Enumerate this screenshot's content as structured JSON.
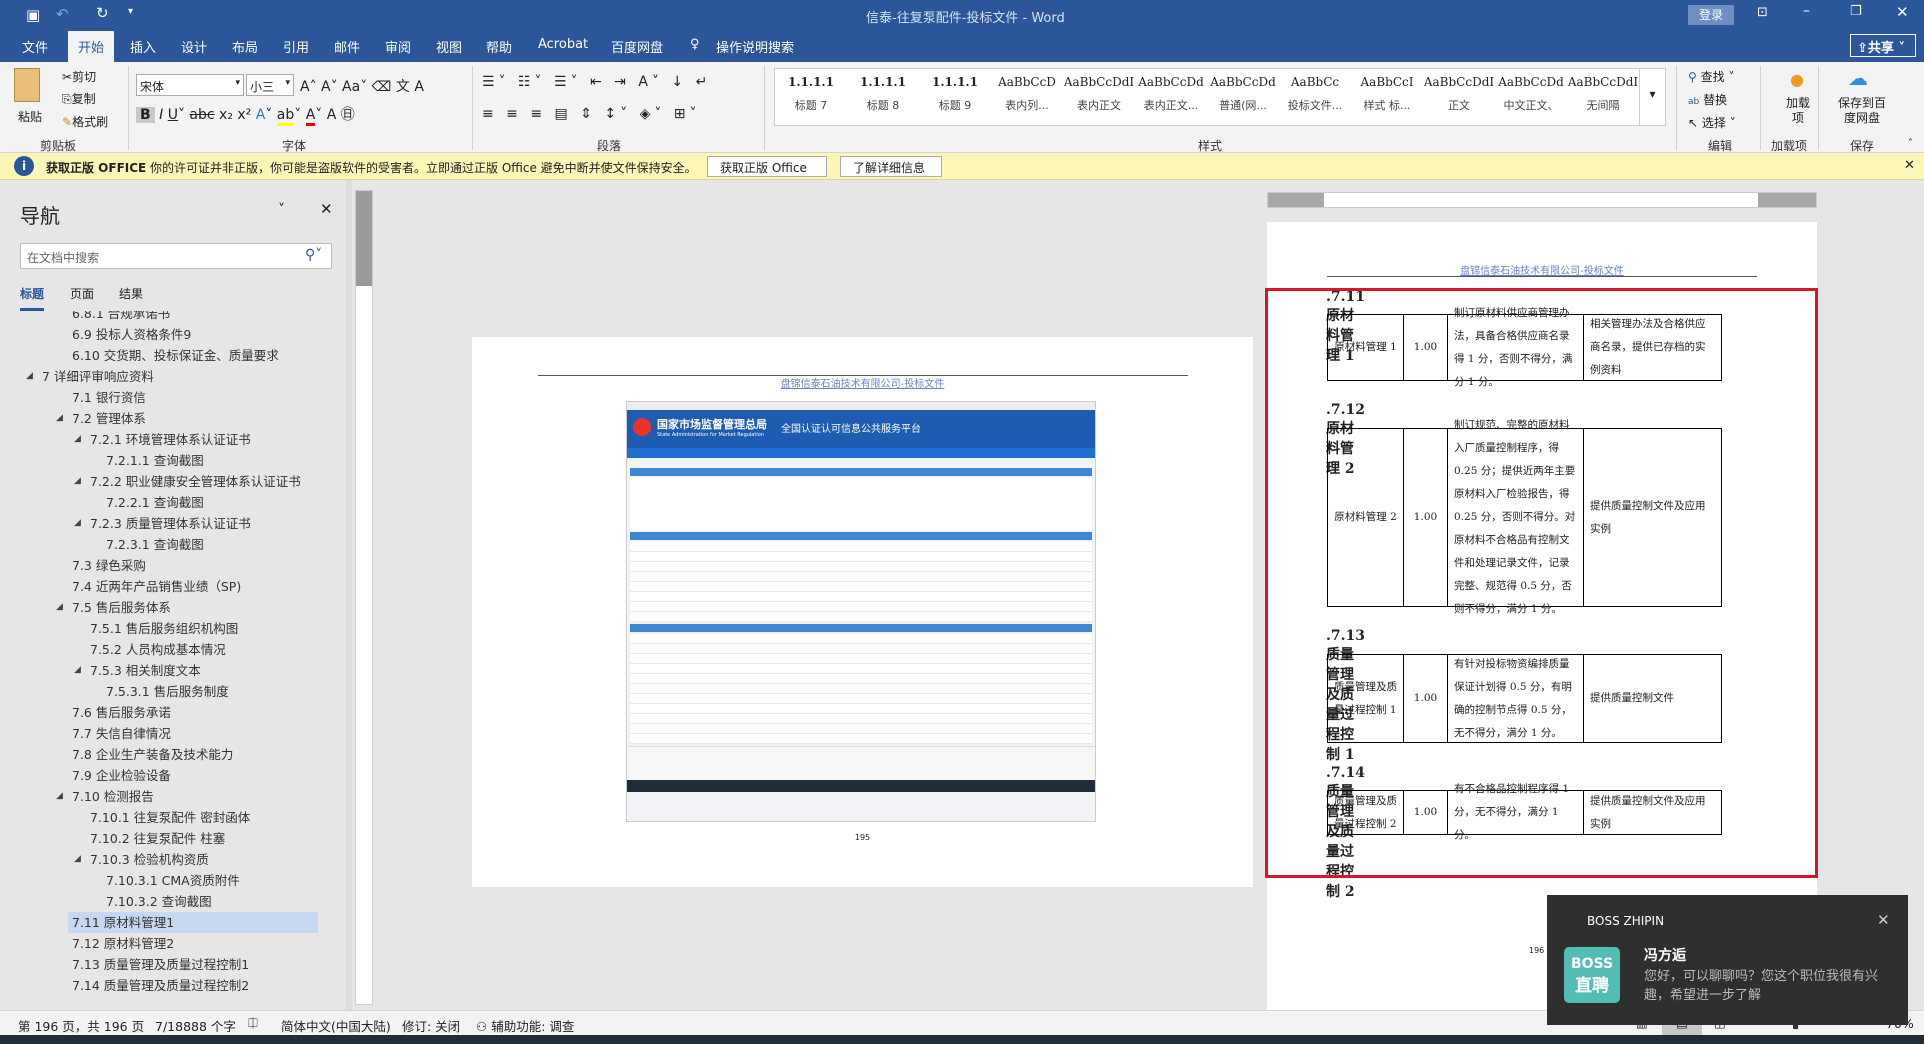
{
  "window": {
    "title": "信泰-往复泵配件-投标文件 - Word",
    "login": "登录"
  },
  "tabs": [
    "文件",
    "开始",
    "插入",
    "设计",
    "布局",
    "引用",
    "邮件",
    "审阅",
    "视图",
    "帮助",
    "Acrobat",
    "百度网盘"
  ],
  "active_tab": "开始",
  "tell_me": "操作说明搜索",
  "share": "共享",
  "ribbon": {
    "clipboard": {
      "paste": "粘贴",
      "cut": "剪切",
      "copy": "复制",
      "format_painter": "格式刷",
      "label": "剪贴板"
    },
    "font": {
      "name": "宋体",
      "size": "小三",
      "label": "字体"
    },
    "paragraph": {
      "label": "段落"
    },
    "styles": {
      "label": "样式",
      "items": [
        {
          "preview": "1.1.1.1",
          "name": "标题 7"
        },
        {
          "preview": "1.1.1.1",
          "name": "标题 8"
        },
        {
          "preview": "1.1.1.1",
          "name": "标题 9"
        },
        {
          "preview": "AaBbCcD",
          "name": "表内列..."
        },
        {
          "preview": "AaBbCcDdI",
          "name": "表内正文"
        },
        {
          "preview": "AaBbCcDd",
          "name": "表内正文..."
        },
        {
          "preview": "AaBbCcDd",
          "name": "普通(网..."
        },
        {
          "preview": "AaBbCc",
          "name": "投标文件..."
        },
        {
          "preview": "AaBbCcI",
          "name": "样式 标..."
        },
        {
          "preview": "AaBbCcDdI",
          "name": "正文"
        },
        {
          "preview": "AaBbCcDd",
          "name": "中文正文、"
        },
        {
          "preview": "AaBbCcDdI",
          "name": "无间隔"
        }
      ]
    },
    "editing": {
      "find": "查找",
      "replace": "替换",
      "select": "选择",
      "label": "编辑"
    },
    "addins": {
      "button": "加载项",
      "label": "加载项"
    },
    "save": {
      "button": "保存到百度网盘",
      "label": "保存"
    }
  },
  "message_bar": {
    "title": "获取正版 OFFICE",
    "text": "你的许可证并非正版，你可能是盗版软件的受害者。立即通过正版 Office 避免中断并使文件保持安全。",
    "btn1": "获取正版 Office",
    "btn2": "了解详细信息"
  },
  "nav": {
    "title": "导航",
    "search_placeholder": "在文档中搜索",
    "tabs": [
      "标题",
      "页面",
      "结果"
    ],
    "items": [
      {
        "t": "6.8.1 合规承诺书",
        "lvl": 2
      },
      {
        "t": "6.9 投标人资格条件9",
        "lvl": 2
      },
      {
        "t": "6.10 交货期、投标保证金、质量要求",
        "lvl": 2
      },
      {
        "t": "7 详细评审响应资料",
        "lvl": 1,
        "exp": true
      },
      {
        "t": "7.1 银行资信",
        "lvl": 2
      },
      {
        "t": "7.2 管理体系",
        "lvl": 2,
        "exp": true
      },
      {
        "t": "7.2.1 环境管理体系认证证书",
        "lvl": 3,
        "exp": true
      },
      {
        "t": "7.2.1.1 查询截图",
        "lvl": 4
      },
      {
        "t": "7.2.2 职业健康安全管理体系认证证书",
        "lvl": 3,
        "exp": true
      },
      {
        "t": "7.2.2.1 查询截图",
        "lvl": 4
      },
      {
        "t": "7.2.3 质量管理体系认证证书",
        "lvl": 3,
        "exp": true
      },
      {
        "t": "7.2.3.1 查询截图",
        "lvl": 4
      },
      {
        "t": "7.3 绿色采购",
        "lvl": 2
      },
      {
        "t": "7.4 近两年产品销售业绩（SP)",
        "lvl": 2
      },
      {
        "t": "7.5 售后服务体系",
        "lvl": 2,
        "exp": true
      },
      {
        "t": "7.5.1 售后服务组织机构图",
        "lvl": 3
      },
      {
        "t": "7.5.2 人员构成基本情况",
        "lvl": 3
      },
      {
        "t": "7.5.3 相关制度文本",
        "lvl": 3,
        "exp": true
      },
      {
        "t": "7.5.3.1 售后服务制度",
        "lvl": 4
      },
      {
        "t": "7.6 售后服务承诺",
        "lvl": 2
      },
      {
        "t": "7.7 失信自律情况",
        "lvl": 2
      },
      {
        "t": "7.8 企业生产装备及技术能力",
        "lvl": 2
      },
      {
        "t": "7.9 企业检验设备",
        "lvl": 2
      },
      {
        "t": "7.10 检测报告",
        "lvl": 2,
        "exp": true
      },
      {
        "t": "7.10.1 往复泵配件 密封函体",
        "lvl": 3
      },
      {
        "t": "7.10.2 往复泵配件 柱塞",
        "lvl": 3
      },
      {
        "t": "7.10.3 检验机构资质",
        "lvl": 3,
        "exp": true
      },
      {
        "t": "7.10.3.1 CMA资质附件",
        "lvl": 4
      },
      {
        "t": "7.10.3.2 查询截图",
        "lvl": 4
      },
      {
        "t": "7.11 原材料管理1",
        "lvl": 2,
        "sel": true
      },
      {
        "t": "7.12 原材料管理2",
        "lvl": 2
      },
      {
        "t": "7.13 质量管理及质量过程控制1",
        "lvl": 2
      },
      {
        "t": "7.14 质量管理及质量过程控制2",
        "lvl": 2
      }
    ]
  },
  "doc": {
    "header": "盘锦信泰石油技术有限公司-投标文件",
    "left_page_number": "195",
    "right_page_number": "196",
    "screenshot": {
      "agency": "国家市场监督管理总局",
      "agency_en": "State Administration for Market Regulation",
      "platform": "全国认证认可信息公共服务平台"
    },
    "sections": [
      {
        "heading": ".7.11  原材料管理 1",
        "row": [
          "原材料管理 1",
          "1.00",
          "制订原材料供应商管理办法，具备合格供应商名录得 1 分，否则不得分，满分 1 分。",
          "相关管理办法及合格供应商名录，提供已存档的实例资料"
        ]
      },
      {
        "heading": ".7.12  原材料管理 2",
        "row": [
          "原材料管理 2",
          "1.00",
          "制订规范、完整的原材料入厂质量控制程序，得 0.25 分；提供近两年主要原材料入厂检验报告，得 0.25 分，否则不得分。对原材料不合格品有控制文件和处理记录文件，记录完整、规范得 0.5 分，否则不得分，满分 1 分。",
          "提供质量控制文件及应用实例"
        ]
      },
      {
        "heading": ".7.13  质量管理及质量过程控制 1",
        "row": [
          "质量管理及质量过程控制 1",
          "1.00",
          "有针对投标物资编排质量保证计划得 0.5 分，有明确的控制节点得 0.5 分，无不得分，满分 1 分。",
          "提供质量控制文件"
        ]
      },
      {
        "heading": ".7.14  质量管理及质量过程控制 2",
        "row": [
          "质量管理及质量过程控制 2",
          "1.00",
          "有不合格品控制程序得 1 分，无不得分，满分 1 分。",
          "提供质量控制文件及应用实例"
        ]
      }
    ]
  },
  "status": {
    "page": "第 196 页，共 196 页",
    "words": "7/18888 个字",
    "language": "简体中文(中国大陆)",
    "track": "修订: 关闭",
    "accessibility": "辅助功能: 调查",
    "zoom": "70%"
  },
  "notification": {
    "app": "BOSS ZHIPIN",
    "logo_top": "BOSS",
    "logo_bottom": "直聘",
    "sender": "冯方逅",
    "message": "您好，可以聊聊吗？您这个职位我很有兴趣，希望进一步了解"
  },
  "colors": {
    "word_blue": "#2b579a",
    "highlight_red": "#d9152a",
    "nav_selected": "#c5d7f1",
    "boss_teal": "#53bdb5"
  }
}
